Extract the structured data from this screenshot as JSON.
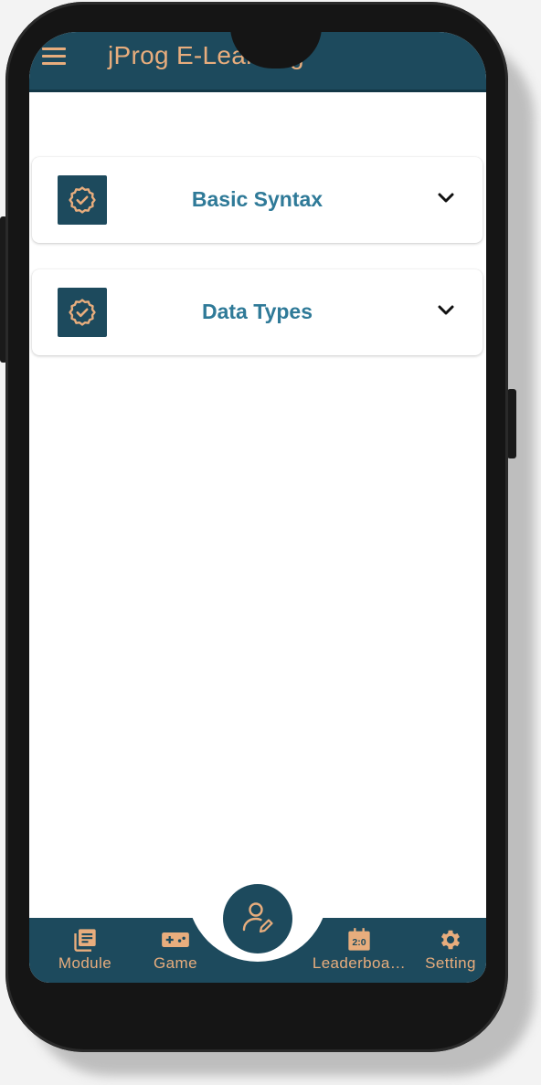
{
  "app": {
    "title": "jProg E-Learning"
  },
  "modules": [
    {
      "title": "Basic Syntax",
      "icon": "badge-check-icon"
    },
    {
      "title": "Data Types",
      "icon": "badge-check-icon"
    }
  ],
  "bottom_nav": {
    "items": [
      {
        "label": "Module",
        "icon": "library-books-icon"
      },
      {
        "label": "Game",
        "icon": "gamepad-icon"
      },
      {
        "label": "Leaderboa…",
        "icon": "scoreboard-icon"
      },
      {
        "label": "Setting",
        "icon": "gear-icon"
      }
    ],
    "fab_icon": "edit-profile-icon"
  },
  "colors": {
    "primary": "#1d4a5d",
    "accent": "#e8ad7d",
    "title_text": "#2f7a98",
    "background": "#ffffff"
  }
}
